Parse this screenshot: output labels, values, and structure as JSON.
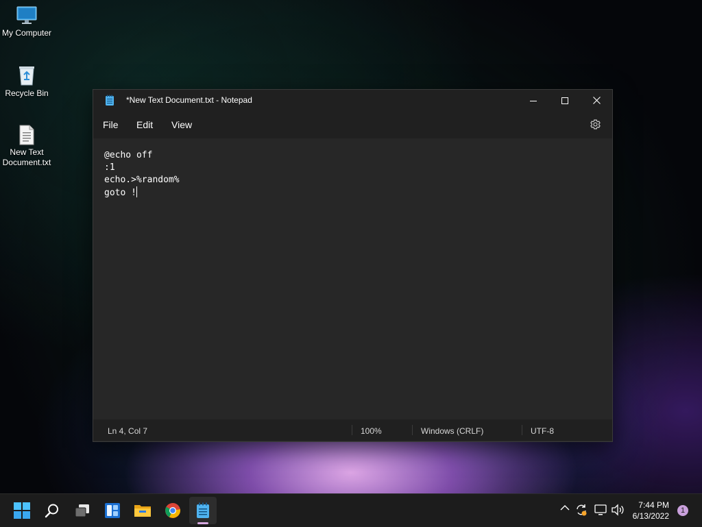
{
  "desktop": {
    "icons": [
      {
        "label": "My Computer"
      },
      {
        "label": "Recycle Bin"
      },
      {
        "label": "New Text Document.txt"
      }
    ]
  },
  "notepad": {
    "title": "*New Text Document.txt - Notepad",
    "menu": {
      "file": "File",
      "edit": "Edit",
      "view": "View"
    },
    "content": "@echo off\n:1\necho.>%random%\ngoto !",
    "status": {
      "position": "Ln 4, Col 7",
      "zoom": "100%",
      "line_endings": "Windows (CRLF)",
      "encoding": "UTF-8"
    }
  },
  "taskbar": {
    "apps": [
      "start-icon",
      "search-icon",
      "task-view-icon",
      "widgets-icon",
      "file-explorer-icon",
      "chrome-icon",
      "notepad-icon"
    ],
    "time": "7:44 PM",
    "date": "6/13/2022",
    "notification_count": "1"
  },
  "colors": {
    "window_bg": "#272727",
    "titlebar_bg": "#202020",
    "taskbar_bg": "#1c1c1c",
    "accent_blue": "#0078d4"
  }
}
